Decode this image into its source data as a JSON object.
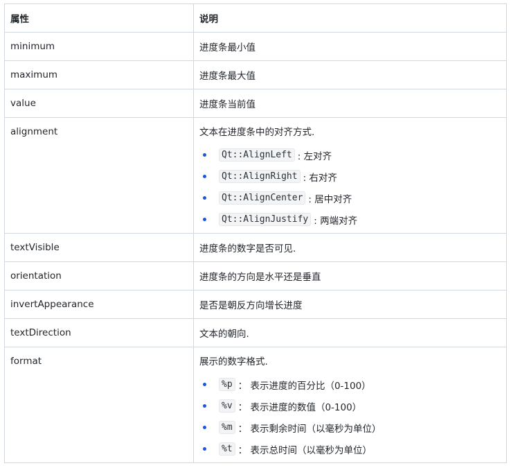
{
  "table": {
    "headers": [
      "属性",
      "说明"
    ],
    "rows": [
      {
        "prop": "minimum",
        "desc": "进度条最小值"
      },
      {
        "prop": "maximum",
        "desc": "进度条最大值"
      },
      {
        "prop": "value",
        "desc": "进度条当前值"
      },
      {
        "prop": "alignment",
        "desc": "文本在进度条中的对齐方式.",
        "options": [
          {
            "code": "Qt::AlignLeft",
            "text": ": 左对齐"
          },
          {
            "code": "Qt::AlignRight",
            "text": ": 右对齐"
          },
          {
            "code": "Qt::AlignCenter",
            "text": ": 居中对齐"
          },
          {
            "code": "Qt::AlignJustify",
            "text": ": 两端对齐"
          }
        ]
      },
      {
        "prop": "textVisible",
        "desc": "进度条的数字是否可见."
      },
      {
        "prop": "orientation",
        "desc": "进度条的方向是水平还是垂直"
      },
      {
        "prop": "invertAppearance",
        "desc": "是否是朝反方向增长进度"
      },
      {
        "prop": "textDirection",
        "desc": "文本的朝向."
      },
      {
        "prop": "format",
        "desc": "展示的数字格式.",
        "options": [
          {
            "code": "%p",
            "text": "： 表示进度的百分比（0-100）"
          },
          {
            "code": "%v",
            "text": "： 表示进度的数值（0-100）"
          },
          {
            "code": "%m",
            "text": "： 表示剩余时间（以毫秒为单位）"
          },
          {
            "code": "%t",
            "text": "： 表示总时间（以毫秒为单位）"
          }
        ]
      }
    ]
  },
  "colors": {
    "border": "#d0d7de",
    "bullet": "#1a56db",
    "code_bg": "#f3f4f6"
  }
}
